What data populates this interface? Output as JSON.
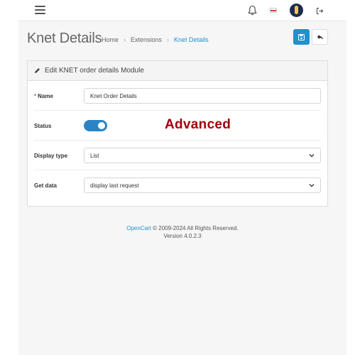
{
  "header": {
    "title": "Knet Details",
    "breadcrumb": [
      "Home",
      "Extensions",
      "Knet Details"
    ]
  },
  "topbar": {
    "icons": [
      "menu-icon",
      "bell-icon",
      "flag-icon",
      "avatar",
      "logout-icon"
    ]
  },
  "card": {
    "title": "Edit KNET order details Module"
  },
  "form": {
    "name_label": "Name",
    "name_value": "Knet Order Details",
    "status_label": "Status",
    "status_on": true,
    "overlay_text": "Advanced",
    "display_type_label": "Display type",
    "display_type_value": "List",
    "get_data_label": "Get data",
    "get_data_value": "display last request"
  },
  "footer": {
    "brand": "OpenCart",
    "copyright": " © 2009-2024 All Rights Reserved.",
    "version": "Version 4.0.2.3"
  },
  "colors": {
    "primary": "#1e91cf",
    "toggle": "#2a84c4",
    "overlay": "#a1000d",
    "required": "#d9534f"
  }
}
